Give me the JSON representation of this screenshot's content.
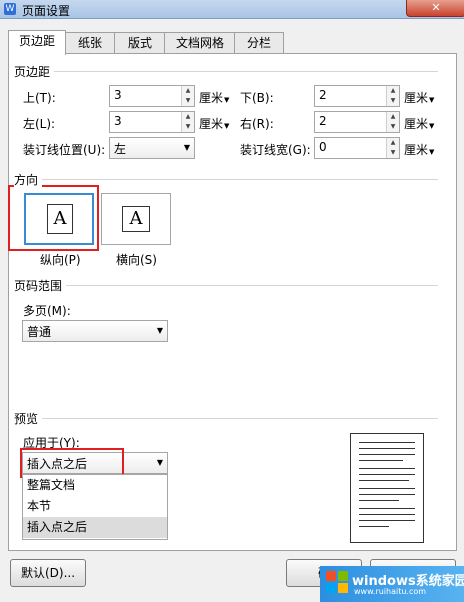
{
  "window": {
    "title": "页面设置",
    "close_glyph": "✕",
    "app_icon": "W"
  },
  "tabs": [
    {
      "label": "页边距",
      "active": true
    },
    {
      "label": "纸张"
    },
    {
      "label": "版式"
    },
    {
      "label": "文档网格"
    },
    {
      "label": "分栏"
    }
  ],
  "margins": {
    "group_title": "页边距",
    "top": {
      "label": "上(T):",
      "value": "3",
      "unit": "厘米"
    },
    "bottom": {
      "label": "下(B):",
      "value": "2",
      "unit": "厘米"
    },
    "left": {
      "label": "左(L):",
      "value": "3",
      "unit": "厘米"
    },
    "right": {
      "label": "右(R):",
      "value": "2",
      "unit": "厘米"
    },
    "gutter_pos": {
      "label": "装订线位置(U):",
      "value": "左"
    },
    "gutter_width": {
      "label": "装订线宽(G):",
      "value": "0",
      "unit": "厘米"
    }
  },
  "orientation": {
    "group_title": "方向",
    "portrait": {
      "label": "纵向(P)",
      "glyph": "A",
      "selected": true
    },
    "landscape": {
      "label": "横向(S)",
      "glyph": "A"
    }
  },
  "page_range": {
    "group_title": "页码范围",
    "multiple_label": "多页(M):",
    "multiple_value": "普通"
  },
  "preview": {
    "group_title": "预览",
    "apply_label": "应用于(Y):",
    "apply_value": "插入点之后",
    "options": [
      "整篇文档",
      "本节",
      "插入点之后"
    ],
    "selected_option": 2
  },
  "buttons": {
    "default": "默认(D)...",
    "ok_partial": "确"
  },
  "watermark": {
    "brand": "windows系统家园",
    "url": "www.ruihaitu.com"
  },
  "colors": {
    "highlight_red": "#e02020",
    "title_bar": "#a9c4e6",
    "watermark_blue": "#2c8ee0"
  }
}
